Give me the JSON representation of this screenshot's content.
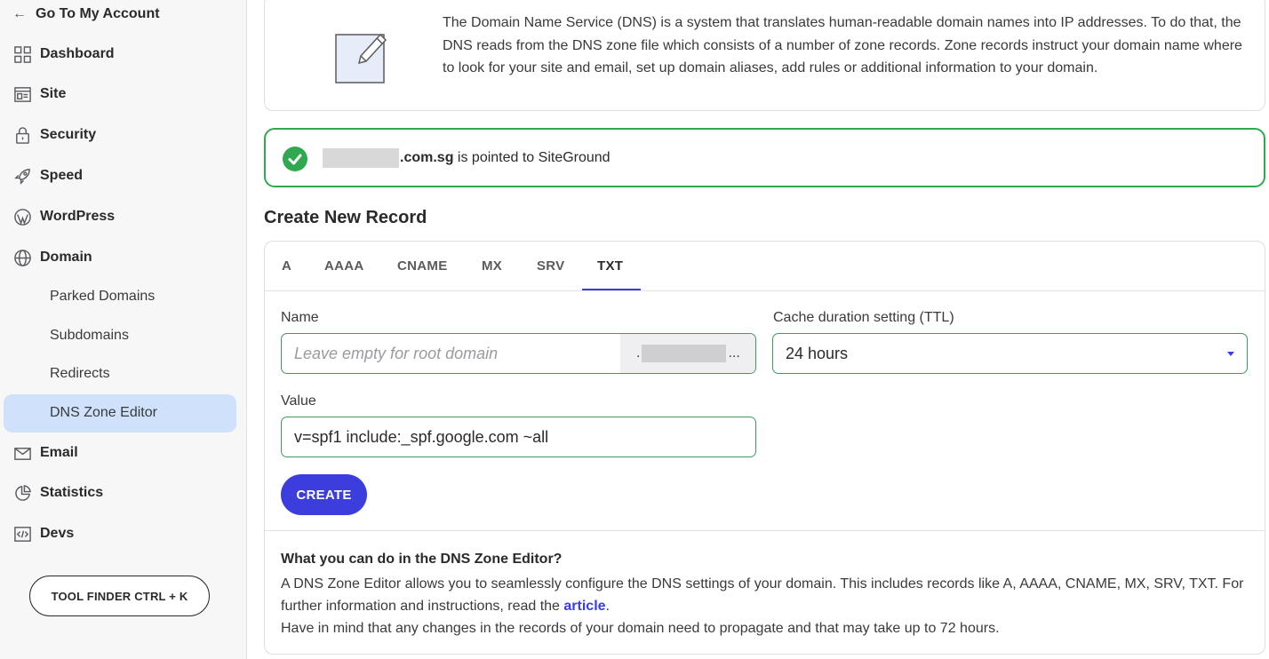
{
  "sidebar": {
    "back_label": "Go To My Account",
    "items": [
      {
        "label": "Dashboard",
        "icon": "dashboard-icon"
      },
      {
        "label": "Site",
        "icon": "site-icon"
      },
      {
        "label": "Security",
        "icon": "lock-icon"
      },
      {
        "label": "Speed",
        "icon": "rocket-icon"
      },
      {
        "label": "WordPress",
        "icon": "wordpress-icon"
      },
      {
        "label": "Domain",
        "icon": "globe-icon"
      },
      {
        "label": "Email",
        "icon": "mail-icon"
      },
      {
        "label": "Statistics",
        "icon": "pie-chart-icon"
      },
      {
        "label": "Devs",
        "icon": "code-icon"
      }
    ],
    "domain_subitems": [
      "Parked Domains",
      "Subdomains",
      "Redirects",
      "DNS Zone Editor"
    ],
    "active_subitem": "DNS Zone Editor",
    "tool_finder_label": "TOOL FINDER CTRL + K"
  },
  "info": {
    "text": "The Domain Name Service (DNS) is a system that translates human-readable domain names into IP addresses. To do that, the DNS reads from the DNS zone file which consists of a number of zone records. Zone records instruct your domain name where to look for your site and email, set up domain aliases, add rules or additional information to your domain."
  },
  "status": {
    "domain_suffix": ".com.sg",
    "message": " is pointed to SiteGround",
    "color": "#2fa84f"
  },
  "create_record": {
    "title": "Create New Record",
    "tabs": [
      "A",
      "AAAA",
      "CNAME",
      "MX",
      "SRV",
      "TXT"
    ],
    "active_tab": "TXT",
    "name_label": "Name",
    "name_placeholder": "Leave empty for root domain",
    "name_suffix_prefix": ".",
    "name_suffix_ellipsis": "...",
    "ttl_label": "Cache duration setting (TTL)",
    "ttl_value": "24 hours",
    "value_label": "Value",
    "value_value": "v=spf1 include:_spf.google.com ~all",
    "create_button": "CREATE",
    "accent_color": "#3b3ddd"
  },
  "help": {
    "title": "What you can do in the DNS Zone Editor?",
    "line1": "A DNS Zone Editor allows you to seamlessly configure the DNS settings of your domain. This includes records like A, AAAA, CNAME, MX, SRV, TXT. For further information and instructions, read the ",
    "link": "article",
    "line1_end": ".",
    "line2": "Have in mind that any changes in the records of your domain need to propagate and that may take up to 72 hours."
  }
}
